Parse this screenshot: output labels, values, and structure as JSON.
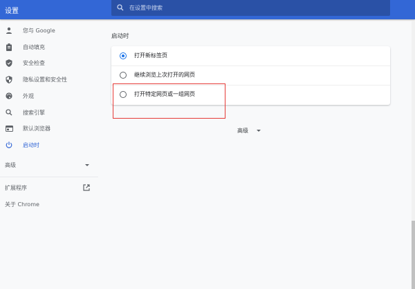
{
  "header": {
    "title": "设置",
    "search_placeholder": "在设置中搜索"
  },
  "sidebar": {
    "items": [
      {
        "label": "您与 Google",
        "icon": "person-icon"
      },
      {
        "label": "自动填充",
        "icon": "clipboard-icon"
      },
      {
        "label": "安全检查",
        "icon": "shield-check-icon"
      },
      {
        "label": "隐私设置和安全性",
        "icon": "privacy-shield-icon"
      },
      {
        "label": "外观",
        "icon": "palette-icon"
      },
      {
        "label": "搜索引擎",
        "icon": "search-icon"
      },
      {
        "label": "默认浏览器",
        "icon": "browser-icon"
      },
      {
        "label": "启动时",
        "icon": "power-icon",
        "active": true
      }
    ],
    "advanced": "高级",
    "extensions": "扩展程序",
    "about": "关于 Chrome"
  },
  "main": {
    "section_title": "启动时",
    "options": [
      {
        "label": "打开新标签页",
        "selected": true
      },
      {
        "label": "继续浏览上次打开的网页",
        "selected": false
      },
      {
        "label": "打开特定网页或一组网页",
        "selected": false
      }
    ],
    "advanced": "高级"
  },
  "colors": {
    "header": "#3367d6",
    "accent": "#1a73e8",
    "highlight": "#e53935"
  }
}
